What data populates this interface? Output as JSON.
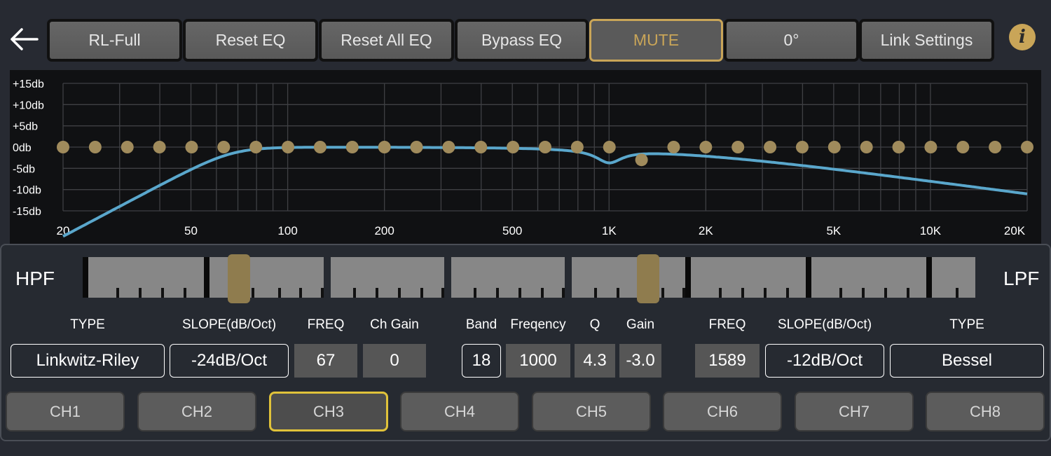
{
  "toolbar": {
    "buttons": [
      "RL-Full",
      "Reset EQ",
      "Reset All EQ",
      "Bypass EQ",
      "MUTE",
      "0°",
      "Link Settings"
    ],
    "info_glyph": "i",
    "back_icon": "arrow-left-icon"
  },
  "colors": {
    "accent": "#c9a558",
    "curve": "#5aa7cc",
    "active_channel_border": "#e0c23a",
    "graph_bg": "#101113",
    "panel_bg": "#262a31"
  },
  "graph": {
    "y_labels": [
      "+15db",
      "+10db",
      "+5db",
      "0db",
      "-5db",
      "-10db",
      "-15db"
    ],
    "x_labels": [
      "20",
      "50",
      "100",
      "200",
      "500",
      "1K",
      "2K",
      "5K",
      "10K",
      "20K"
    ],
    "band_points_db": [
      0,
      0,
      0,
      0,
      0,
      0,
      0,
      0,
      0,
      0,
      0,
      0,
      0,
      0,
      0,
      0,
      0,
      0,
      -3,
      0,
      0,
      0,
      0,
      0,
      0,
      0,
      0,
      0,
      0,
      0,
      0
    ]
  },
  "filter": {
    "hpf_label": "HPF",
    "lpf_label": "LPF",
    "hpf": {
      "type_label": "TYPE",
      "type": "Linkwitz-Riley",
      "slope_label": "SLOPE(dB/Oct)",
      "slope": "-24dB/Oct",
      "freq_label": "FREQ",
      "freq": "67"
    },
    "ch_gain_label": "Ch Gain",
    "ch_gain": "0",
    "peq": {
      "band_label": "Band",
      "band": "18",
      "freq_label": "Freqency",
      "freq": "1000",
      "q_label": "Q",
      "q": "4.3",
      "gain_label": "Gain",
      "gain": "-3.0"
    },
    "lpf": {
      "freq_label": "FREQ",
      "freq": "1589",
      "slope_label": "SLOPE(dB/Oct)",
      "slope": "-12dB/Oct",
      "type_label": "TYPE",
      "type": "Bessel"
    }
  },
  "channels": {
    "items": [
      "CH1",
      "CH2",
      "CH3",
      "CH4",
      "CH5",
      "CH6",
      "CH7",
      "CH8"
    ],
    "active": "CH3"
  }
}
